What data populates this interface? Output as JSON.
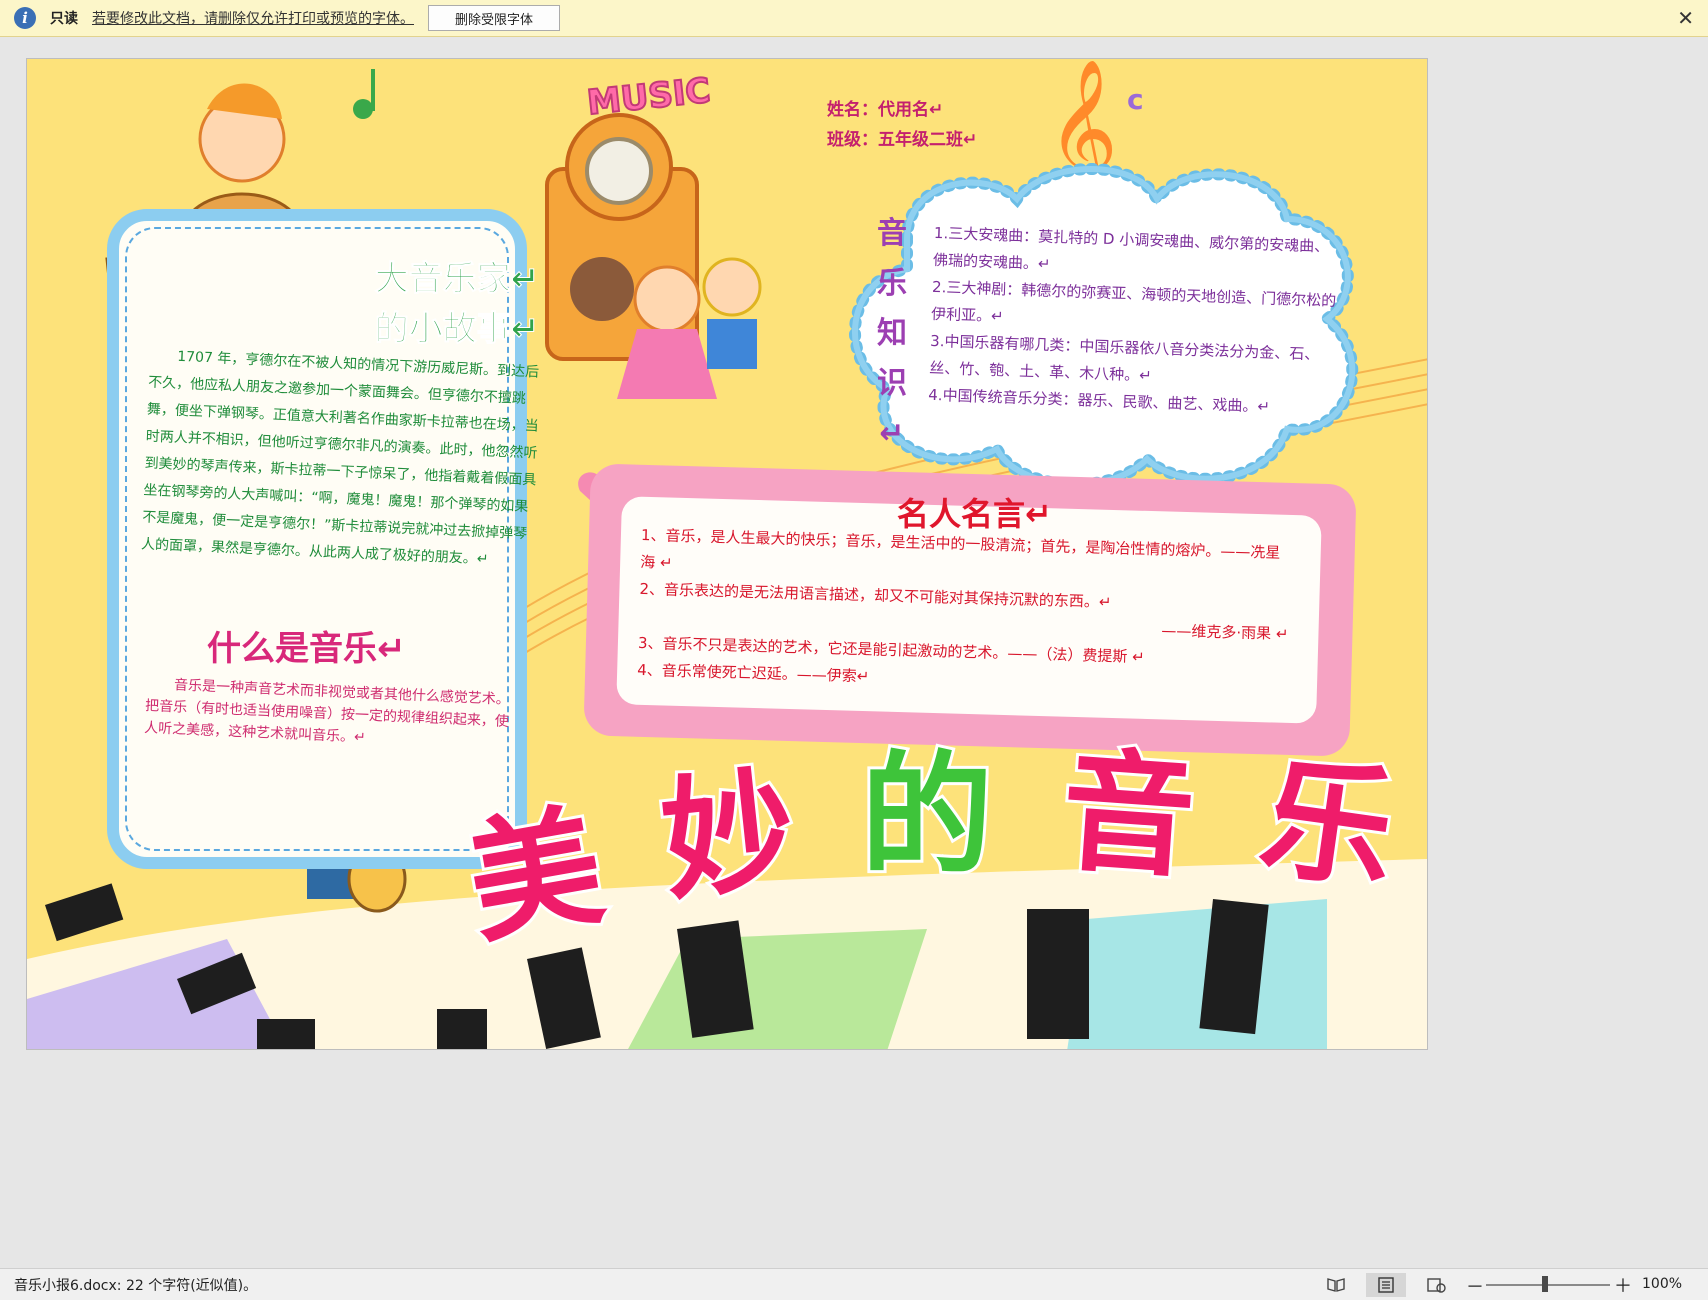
{
  "infobar": {
    "icon": "info-icon",
    "readonly_label": "只读",
    "message": "若要修改此文档，请删除仅允许打印或预览的字体。",
    "remove_button": "删除受限字体",
    "close_icon": "close-icon"
  },
  "document": {
    "student_name": "姓名：代用名↵",
    "student_class": "班级：五年级二班↵",
    "music_sign": "MUSIC",
    "story_title_1": "大音乐家↵",
    "story_title_2": "的小故事↵",
    "story_text": "1707 年，亨德尔在不被人知的情况下游历威尼斯。到达后不久，他应私人朋友之邀参加一个蒙面舞会。但亨德尔不擅跳舞，便坐下弹钢琴。正值意大利著名作曲家斯卡拉蒂也在场，当时两人并不相识，但他听过亨德尔非凡的演奏。此时，他忽然听到美妙的琴声传来，斯卡拉蒂一下子惊呆了，他指着戴着假面具坐在钢琴旁的人大声喊叫：“啊，魔鬼！魔鬼！那个弹琴的如果不是魔鬼，便一定是亨德尔！”斯卡拉蒂说完就冲过去掀掉弹琴人的面罩，果然是亨德尔。从此两人成了极好的朋友。↵",
    "what_title": "什么是音乐↵",
    "what_text": "音乐是一种声音艺术而非视觉或者其他什么感觉艺术。把音乐（有时也适当使用噪音）按一定的规律组织起来，使人听之美感，这种艺术就叫音乐。↵",
    "knowledge_title": [
      "音",
      "乐",
      "知",
      "识↵"
    ],
    "knowledge_items": [
      "1.三大安魂曲：莫扎特的 D 小调安魂曲、威尔第的安魂曲、佛瑞的安魂曲。↵",
      "2.三大神剧：韩德尔的弥赛亚、海顿的天地创造、门德尔松的伊利亚。↵",
      "3.中国乐器有哪几类：中国乐器依八音分类法分为金、石、丝、竹、匏、土、革、木八种。↵",
      "4.中国传统音乐分类：器乐、民歌、曲艺、戏曲。↵"
    ],
    "quote_title": "名人名言↵",
    "quotes": [
      "1、音乐，是人生最大的快乐；音乐，是生活中的一股清流；首先，是陶冶性情的熔炉。——冼星海 ↵",
      "2、音乐表达的是无法用语言描述，却又不可能对其保持沉默的东西。↵",
      "——维克多·雨果 ↵",
      "3、音乐不只是表达的艺术，它还是能引起激动的艺术。——（法）费提斯 ↵",
      "4、音乐常使死亡迟延。——伊索↵"
    ],
    "headline": [
      "美",
      "妙",
      "的",
      "音",
      "乐"
    ],
    "headline_colors": [
      "#ef1c6a",
      "#ef1c6a",
      "#3ec43a",
      "#ef1c6a",
      "#ef1c6a"
    ]
  },
  "statusbar": {
    "text": "音乐小报6.docx: 22 个字符(近似值)。",
    "zoom_minus": "－",
    "zoom_plus": "＋",
    "zoom": "100%"
  }
}
